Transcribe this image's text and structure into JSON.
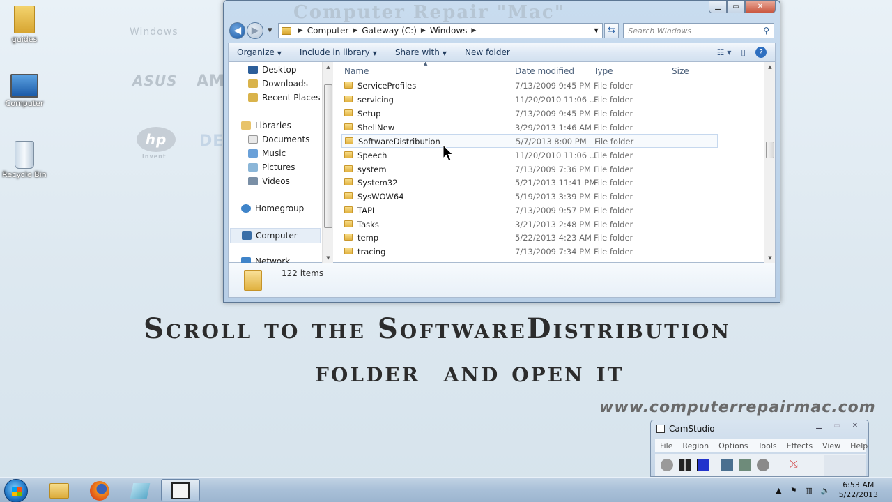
{
  "desktop": {
    "icons": [
      {
        "label": "guides"
      },
      {
        "label": "Computer"
      },
      {
        "label": "Recycle Bin"
      }
    ],
    "brands": [
      "Windows",
      "ASUS",
      "AM",
      "hp",
      "invent",
      "DE"
    ]
  },
  "window": {
    "bg_title": "Computer Repair \"Mac\"",
    "address": {
      "crumbs": [
        "Computer",
        "Gateway (C:)",
        "Windows"
      ]
    },
    "search_placeholder": "Search Windows",
    "toolbar": {
      "organize": "Organize",
      "include_in_library": "Include in library",
      "share_with": "Share with",
      "new_folder": "New folder"
    },
    "nav": {
      "favorites": [
        "Desktop",
        "Downloads",
        "Recent Places"
      ],
      "libraries": "Libraries",
      "library_items": [
        "Documents",
        "Music",
        "Pictures",
        "Videos"
      ],
      "homegroup": "Homegroup",
      "computer": "Computer",
      "network": "Network"
    },
    "columns": {
      "name": "Name",
      "date": "Date modified",
      "type": "Type",
      "size": "Size"
    },
    "files": [
      {
        "name": "ServiceProfiles",
        "date": "7/13/2009 9:45 PM",
        "type": "File folder"
      },
      {
        "name": "servicing",
        "date": "11/20/2010 11:06 ...",
        "type": "File folder"
      },
      {
        "name": "Setup",
        "date": "7/13/2009 9:45 PM",
        "type": "File folder"
      },
      {
        "name": "ShellNew",
        "date": "3/29/2013 1:46 AM",
        "type": "File folder"
      },
      {
        "name": "SoftwareDistribution",
        "date": "5/7/2013 8:00 PM",
        "type": "File folder"
      },
      {
        "name": "Speech",
        "date": "11/20/2010 11:06 ...",
        "type": "File folder"
      },
      {
        "name": "system",
        "date": "7/13/2009 7:36 PM",
        "type": "File folder"
      },
      {
        "name": "System32",
        "date": "5/21/2013 11:41 PM",
        "type": "File folder"
      },
      {
        "name": "SysWOW64",
        "date": "5/19/2013 3:39 PM",
        "type": "File folder"
      },
      {
        "name": "TAPI",
        "date": "7/13/2009 9:57 PM",
        "type": "File folder"
      },
      {
        "name": "Tasks",
        "date": "3/21/2013 2:48 PM",
        "type": "File folder"
      },
      {
        "name": "temp",
        "date": "5/22/2013 4:23 AM",
        "type": "File folder"
      },
      {
        "name": "tracing",
        "date": "7/13/2009 7:34 PM",
        "type": "File folder"
      }
    ],
    "status": {
      "count": "122 items"
    }
  },
  "overlay": {
    "line1": "Scroll to the SoftwareDistribution",
    "line2": "folder  and open it",
    "website": "www.computerrepairmac.com"
  },
  "camstudio": {
    "title": "CamStudio",
    "menu": [
      "File",
      "Region",
      "Options",
      "Tools",
      "Effects",
      "View",
      "Help"
    ]
  },
  "taskbar": {
    "time": "6:53 AM",
    "date": "5/22/2013"
  }
}
